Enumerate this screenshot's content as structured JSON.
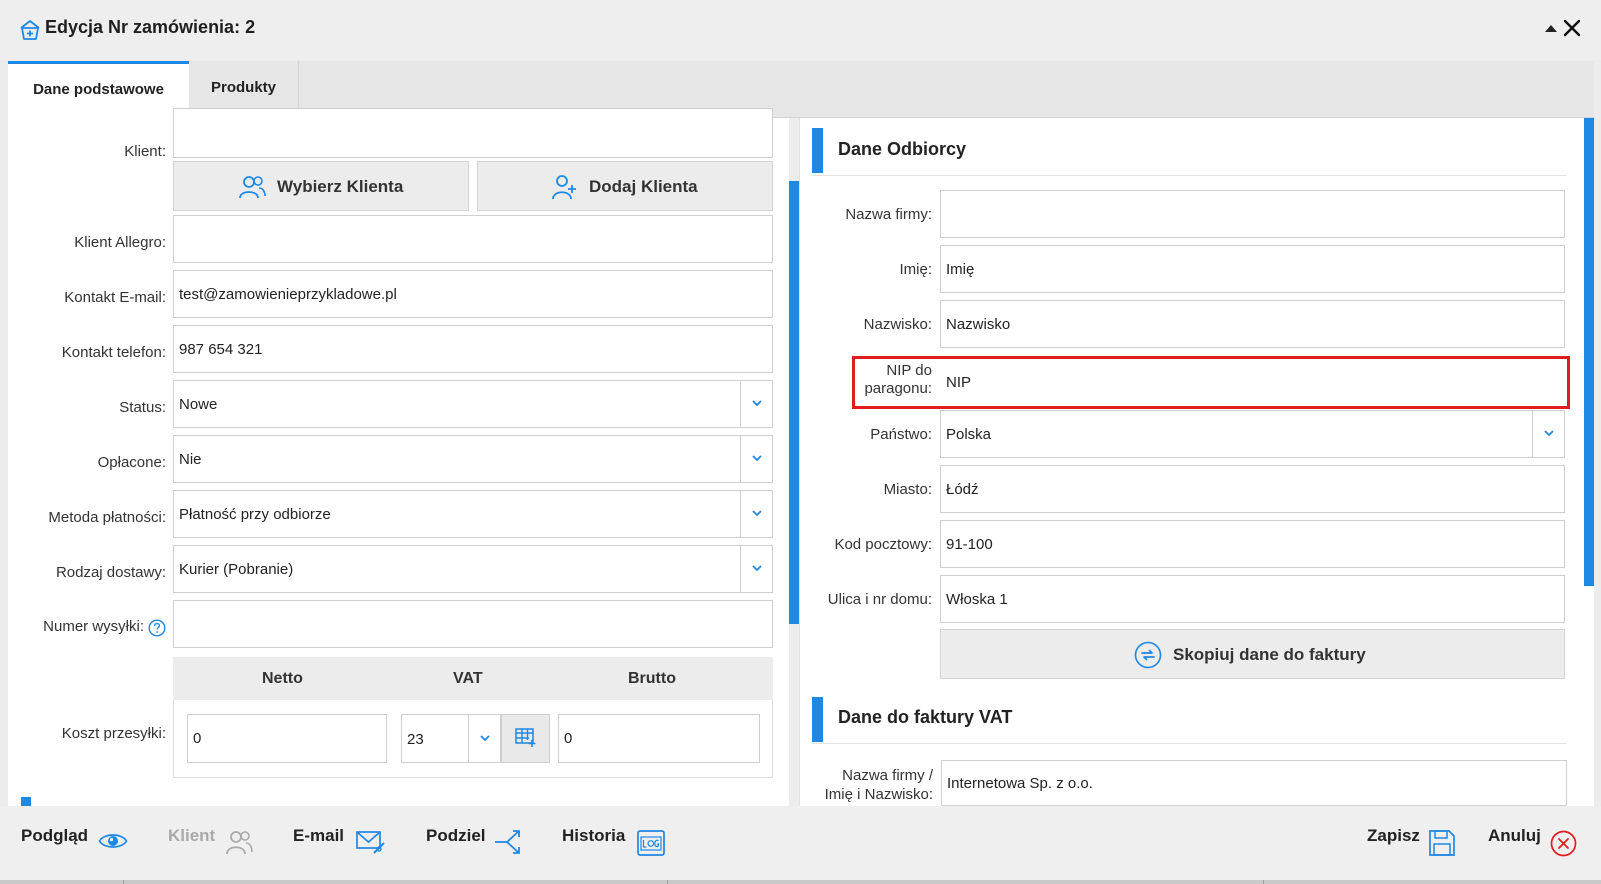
{
  "window": {
    "title": "Edycja Nr zamówienia: 2"
  },
  "tabs": [
    {
      "label": "Dane podstawowe",
      "active": true
    },
    {
      "label": "Produkty",
      "active": false
    }
  ],
  "left": {
    "client_label": "Klient:",
    "choose_client": "Wybierz Klienta",
    "add_client": "Dodaj Klienta",
    "allegro_label": "Klient Allegro:",
    "allegro_value": "",
    "email_label": "Kontakt E-mail:",
    "email_value": "test@zamowienieprzykladowe.pl",
    "phone_label": "Kontakt telefon:",
    "phone_value": "987 654 321",
    "status_label": "Status:",
    "status_value": "Nowe",
    "paid_label": "Opłacone:",
    "paid_value": "Nie",
    "payment_label": "Metoda płatności:",
    "payment_value": "Płatność przy odbiorze",
    "delivery_label": "Rodzaj dostawy:",
    "delivery_value": "Kurier (Pobranie)",
    "shipment_label": "Numer wysyłki:",
    "shipment_value": "",
    "cost": {
      "label": "Koszt przesyłki:",
      "netto_header": "Netto",
      "vat_header": "VAT",
      "brutto_header": "Brutto",
      "netto_value": "0",
      "vat_value": "23",
      "brutto_value": "0"
    }
  },
  "right": {
    "recipient_title": "Dane Odbiorcy",
    "company_label": "Nazwa firmy:",
    "company_value": "",
    "first_name_label": "Imię:",
    "first_name_value": "Imię",
    "last_name_label": "Nazwisko:",
    "last_name_value": "Nazwisko",
    "nip_label_line1": "NIP do",
    "nip_label_line2": "paragonu:",
    "nip_value": "NIP",
    "country_label": "Państwo:",
    "country_value": "Polska",
    "city_label": "Miasto:",
    "city_value": "Łódź",
    "postal_label": "Kod pocztowy:",
    "postal_value": "91-100",
    "street_label": "Ulica i nr domu:",
    "street_value": "Włoska 1",
    "copy_button": "Skopiuj dane do faktury",
    "invoice_title": "Dane do faktury VAT",
    "invoice_name_label_line1": "Nazwa firmy /",
    "invoice_name_label_line2": "Imię i Nazwisko:",
    "invoice_name_value": "Internetowa Sp. z o.o."
  },
  "bottom": {
    "preview": "Podgląd",
    "client": "Klient",
    "email": "E-mail",
    "split": "Podziel",
    "history": "Historia",
    "save": "Zapisz",
    "cancel": "Anuluj"
  },
  "colors": {
    "accent": "#1e88e5",
    "highlight": "#e01e1e",
    "disabled": "#a9a9a9"
  }
}
